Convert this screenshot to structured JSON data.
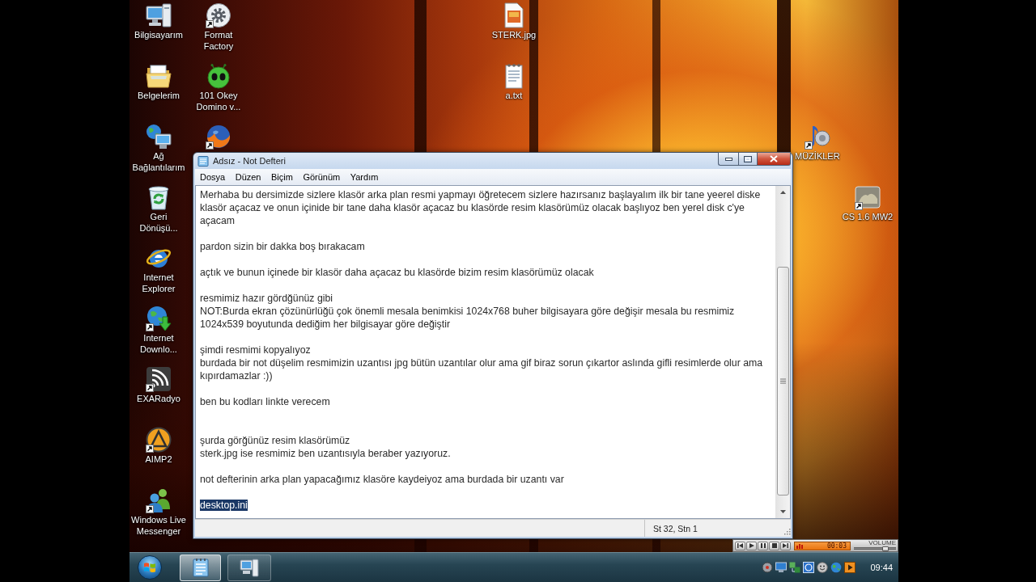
{
  "desktop_icons": [
    {
      "label": "Bilgisayarım",
      "kind": "computer",
      "shortcut": false
    },
    {
      "label": "Belgelerim",
      "kind": "documents",
      "shortcut": false
    },
    {
      "label": "Ağ Bağlantılarım",
      "kind": "network",
      "shortcut": false
    },
    {
      "label": "Geri Dönüşü...",
      "kind": "recycle",
      "shortcut": false
    },
    {
      "label": "Internet Explorer",
      "kind": "explorer",
      "shortcut": false
    },
    {
      "label": "Internet Downlo...",
      "kind": "download",
      "shortcut": true
    },
    {
      "label": "EXARadyo",
      "kind": "radio",
      "shortcut": true
    },
    {
      "label": "AIMP2",
      "kind": "player",
      "shortcut": true
    },
    {
      "label": "Windows Live Messenger",
      "kind": "messenger",
      "shortcut": true
    },
    {
      "label": "Format Factory",
      "kind": "factory",
      "shortcut": true
    },
    {
      "label": "101 Okey Domino v...",
      "kind": "game",
      "shortcut": false
    },
    {
      "kind": "browser",
      "shortcut": true
    },
    {
      "label": "STERK.jpg",
      "kind": "image",
      "shortcut": false
    },
    {
      "label": "a.txt",
      "kind": "text",
      "shortcut": false
    },
    {
      "label": "MÜZİKLER",
      "kind": "music",
      "shortcut": true
    },
    {
      "label": "CS 1.6 MW2",
      "kind": "thumbnail",
      "shortcut": true
    }
  ],
  "notepad": {
    "title": "Adsız - Not Defteri",
    "menu": [
      "Dosya",
      "Düzen",
      "Biçim",
      "Görünüm",
      "Yardım"
    ],
    "lines": [
      {
        "kind": "text",
        "text": "Merhaba bu dersimizde sizlere klasör arka plan resmi yapmayı öğretecem sizlere hazırsanız başlayalım ilk bir tane yeerel diske",
        "selected": false
      },
      {
        "kind": "text",
        "text": "klasör açacaz ve onun içinide bir tane daha klasör açacaz bu klasörde resim klasörümüz olacak başlıyoz ben yerel disk c'ye",
        "selected": false
      },
      {
        "kind": "text",
        "text": "açacam",
        "selected": false
      },
      {
        "kind": "blank"
      },
      {
        "kind": "text",
        "text": "pardon sizin bir dakka boş bırakacam",
        "selected": false
      },
      {
        "kind": "blank"
      },
      {
        "kind": "text",
        "text": "açtık ve bunun içinede bir klasör daha açacaz bu klasörde bizim resim klasörümüz olacak",
        "selected": false
      },
      {
        "kind": "blank"
      },
      {
        "kind": "text",
        "text": "resmimiz hazır gördğünüz gibi",
        "selected": false
      },
      {
        "kind": "text",
        "text": "NOT:Burda ekran çözünürlüğü çok önemli mesala benimkisi 1024x768 buher bilgisayara göre değişir mesala bu resmimiz",
        "selected": false
      },
      {
        "kind": "text",
        "text": "1024x539 boyutunda dediğim her bilgisayar göre değiştir",
        "selected": false
      },
      {
        "kind": "blank"
      },
      {
        "kind": "text",
        "text": "şimdi resmimi kopyalıyoz",
        "selected": false
      },
      {
        "kind": "text",
        "text": "burdada bir not düşelim resmimizin uzantısı jpg bütün uzantılar olur ama gif biraz sorun çıkartor aslında gifli resimlerde olur ama",
        "selected": false
      },
      {
        "kind": "text",
        "text": "kıpırdamazlar :))",
        "selected": false
      },
      {
        "kind": "blank"
      },
      {
        "kind": "text",
        "text": "ben bu kodları linkte verecem",
        "selected": false
      },
      {
        "kind": "blank"
      },
      {
        "kind": "blank"
      },
      {
        "kind": "text",
        "text": "şurda görğünüz resim klasörümüz",
        "selected": false
      },
      {
        "kind": "text",
        "text": "sterk.jpg ise resmimiz ben uzantısıyla beraber yazıyoruz.",
        "selected": false
      },
      {
        "kind": "blank"
      },
      {
        "kind": "text",
        "text": "not defterinin arka plan yapacağımız klasöre kaydeiyoz ama burdada bir uzantı var",
        "selected": false
      },
      {
        "kind": "blank"
      },
      {
        "kind": "text",
        "text": "desktop.ini",
        "selected": true
      }
    ],
    "status": "St 32, Stn 1"
  },
  "media_player": {
    "time": "00:03",
    "volume": {
      "label": "VOLUME",
      "level": 0.8
    }
  },
  "taskbar": {
    "buttons": [
      {
        "kind": "notepad",
        "selected": true
      },
      {
        "kind": "computer",
        "selected": false
      }
    ],
    "clock": "09:44"
  }
}
